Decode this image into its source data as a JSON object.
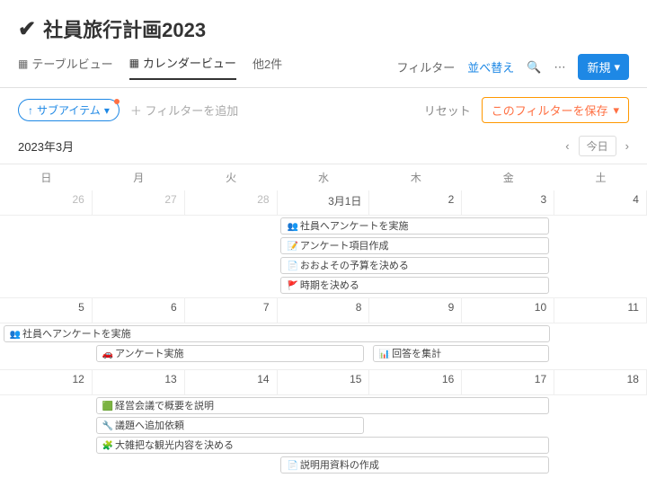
{
  "title": "社員旅行計画2023",
  "views": {
    "table": "テーブルビュー",
    "calendar": "カレンダービュー",
    "others": "他2件"
  },
  "toolbar": {
    "filter": "フィルター",
    "sort": "並べ替え",
    "new": "新規"
  },
  "subbar": {
    "subitems": "サブアイテム",
    "add_filter": "フィルターを追加",
    "reset": "リセット",
    "save_filter": "このフィルターを保存"
  },
  "month": "2023年3月",
  "today": "今日",
  "dow": [
    "日",
    "月",
    "火",
    "水",
    "木",
    "金",
    "土"
  ],
  "days_r1": [
    "26",
    "27",
    "28",
    "3月1日",
    "2",
    "3",
    "4"
  ],
  "days_r2": [
    "5",
    "6",
    "7",
    "8",
    "9",
    "10",
    "11"
  ],
  "days_r3": [
    "12",
    "13",
    "14",
    "15",
    "16",
    "17",
    "18"
  ],
  "events": {
    "r1e1": "社員へアンケートを実施",
    "r1e2": "アンケート項目作成",
    "r1e3": "おおよその予算を決める",
    "r1e4": "時期を決める",
    "r2e1": "社員へアンケートを実施",
    "r2e2": "アンケート実施",
    "r2e3": "回答を集計",
    "r3e1": "経営会議で概要を説明",
    "r3e2": "議題へ追加依頼",
    "r3e3": "大雑把な観光内容を決める",
    "r3e4": "説明用資料の作成"
  },
  "icons": {
    "r1e1": "👥",
    "r1e2": "📝",
    "r1e3": "📄",
    "r1e4": "🚩",
    "r2e1": "👥",
    "r2e2": "🚗",
    "r2e3": "📊",
    "r3e1": "🟩",
    "r3e2": "🔧",
    "r3e3": "🧩",
    "r3e4": "📄"
  }
}
